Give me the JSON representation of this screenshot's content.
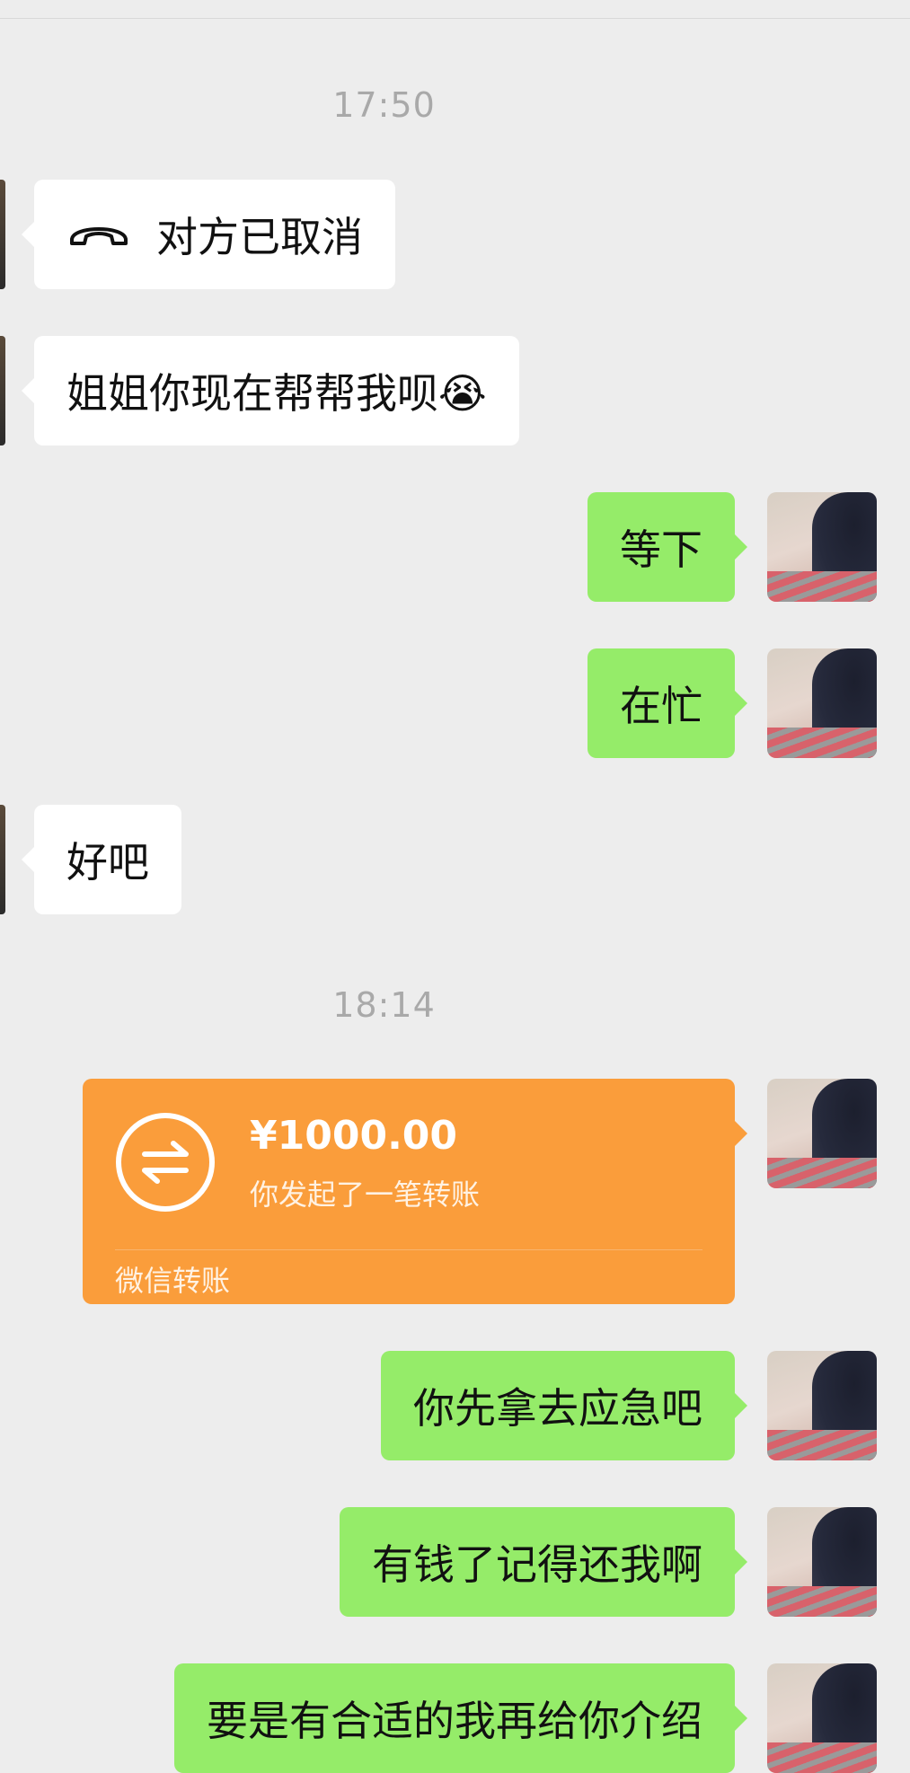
{
  "chat": {
    "timestamps": [
      "17:50",
      "18:14"
    ],
    "messages": [
      {
        "side": "incoming",
        "type": "call",
        "text": "对方已取消",
        "icon": "phone-hangup-icon"
      },
      {
        "side": "incoming",
        "type": "text",
        "text": "姐姐你现在帮帮我呗😭"
      },
      {
        "side": "outgoing",
        "type": "text",
        "text": "等下"
      },
      {
        "side": "outgoing",
        "type": "text",
        "text": "在忙"
      },
      {
        "side": "incoming",
        "type": "text",
        "text": "好吧"
      },
      {
        "side": "outgoing",
        "type": "transfer",
        "amount": "¥1000.00",
        "description": "你发起了一笔转账",
        "footer": "微信转账",
        "icon": "transfer-arrows-icon"
      },
      {
        "side": "outgoing",
        "type": "text",
        "text": "你先拿去应急吧"
      },
      {
        "side": "outgoing",
        "type": "text",
        "text": "有钱了记得还我啊"
      },
      {
        "side": "outgoing",
        "type": "text",
        "text": "要是有合适的我再给你介绍"
      }
    ]
  },
  "colors": {
    "background": "#ededed",
    "outgoing_bubble": "#95ec69",
    "incoming_bubble": "#ffffff",
    "transfer_card": "#fa9d3b",
    "timestamp_text": "#a9a9a9"
  }
}
